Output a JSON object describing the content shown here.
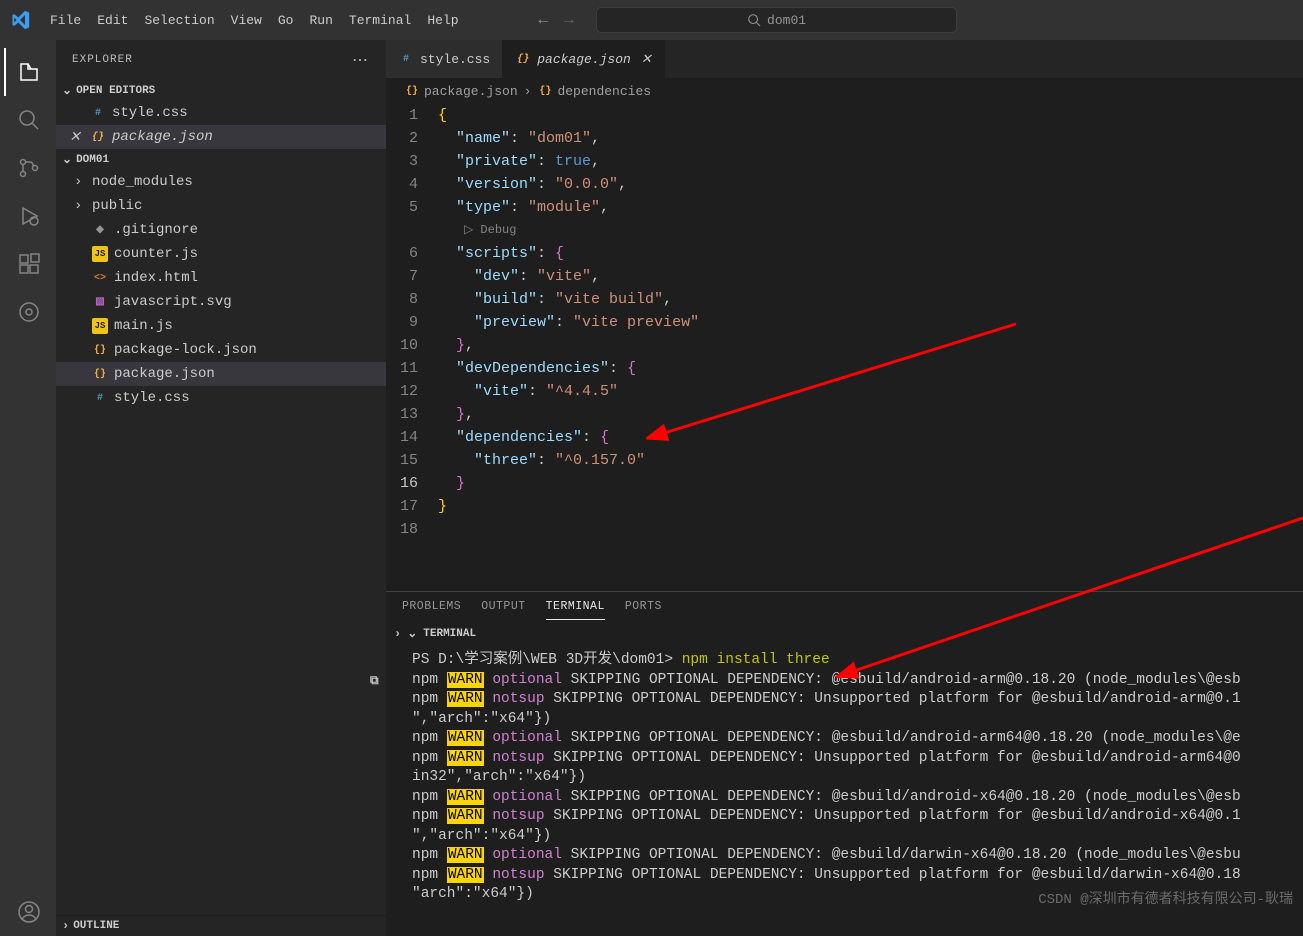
{
  "titlebar": {
    "menu": [
      "File",
      "Edit",
      "Selection",
      "View",
      "Go",
      "Run",
      "Terminal",
      "Help"
    ],
    "search": "dom01"
  },
  "sidebar": {
    "title": "EXPLORER",
    "openEditors": {
      "label": "OPEN EDITORS",
      "items": [
        {
          "name": "style.css",
          "icon": "css"
        },
        {
          "name": "package.json",
          "icon": "json",
          "active": true,
          "italic": true
        }
      ]
    },
    "project": {
      "label": "DOM01",
      "items": [
        {
          "name": "node_modules",
          "type": "folder"
        },
        {
          "name": "public",
          "type": "folder"
        },
        {
          "name": ".gitignore",
          "icon": "git"
        },
        {
          "name": "counter.js",
          "icon": "js"
        },
        {
          "name": "index.html",
          "icon": "html"
        },
        {
          "name": "javascript.svg",
          "icon": "svg"
        },
        {
          "name": "main.js",
          "icon": "js"
        },
        {
          "name": "package-lock.json",
          "icon": "json"
        },
        {
          "name": "package.json",
          "icon": "json",
          "selected": true
        },
        {
          "name": "style.css",
          "icon": "css"
        }
      ]
    },
    "outline": "OUTLINE"
  },
  "tabs": [
    {
      "name": "style.css",
      "icon": "css"
    },
    {
      "name": "package.json",
      "icon": "json",
      "active": true,
      "italic": true
    }
  ],
  "breadcrumb": [
    "package.json",
    "dependencies"
  ],
  "code": {
    "debugLabel": "Debug",
    "lines": [
      {
        "n": 1,
        "tokens": [
          {
            "t": "{",
            "c": "brace"
          }
        ]
      },
      {
        "n": 2,
        "tokens": [
          "  ",
          {
            "t": "\"name\"",
            "c": "key"
          },
          {
            "t": ": ",
            "c": "punct"
          },
          {
            "t": "\"dom01\"",
            "c": "str"
          },
          {
            "t": ",",
            "c": "punct"
          }
        ]
      },
      {
        "n": 3,
        "tokens": [
          "  ",
          {
            "t": "\"private\"",
            "c": "key"
          },
          {
            "t": ": ",
            "c": "punct"
          },
          {
            "t": "true",
            "c": "kw"
          },
          {
            "t": ",",
            "c": "punct"
          }
        ]
      },
      {
        "n": 4,
        "tokens": [
          "  ",
          {
            "t": "\"version\"",
            "c": "key"
          },
          {
            "t": ": ",
            "c": "punct"
          },
          {
            "t": "\"0.0.0\"",
            "c": "str"
          },
          {
            "t": ",",
            "c": "punct"
          }
        ]
      },
      {
        "n": 5,
        "tokens": [
          "  ",
          {
            "t": "\"type\"",
            "c": "key"
          },
          {
            "t": ": ",
            "c": "punct"
          },
          {
            "t": "\"module\"",
            "c": "str"
          },
          {
            "t": ",",
            "c": "punct"
          }
        ]
      },
      {
        "debug": true
      },
      {
        "n": 6,
        "tokens": [
          "  ",
          {
            "t": "\"scripts\"",
            "c": "key"
          },
          {
            "t": ": ",
            "c": "punct"
          },
          {
            "t": "{",
            "c": "brace2"
          }
        ]
      },
      {
        "n": 7,
        "tokens": [
          "    ",
          {
            "t": "\"dev\"",
            "c": "key"
          },
          {
            "t": ": ",
            "c": "punct"
          },
          {
            "t": "\"vite\"",
            "c": "str"
          },
          {
            "t": ",",
            "c": "punct"
          }
        ]
      },
      {
        "n": 8,
        "tokens": [
          "    ",
          {
            "t": "\"build\"",
            "c": "key"
          },
          {
            "t": ": ",
            "c": "punct"
          },
          {
            "t": "\"vite build\"",
            "c": "str"
          },
          {
            "t": ",",
            "c": "punct"
          }
        ]
      },
      {
        "n": 9,
        "tokens": [
          "    ",
          {
            "t": "\"preview\"",
            "c": "key"
          },
          {
            "t": ": ",
            "c": "punct"
          },
          {
            "t": "\"vite preview\"",
            "c": "str"
          }
        ]
      },
      {
        "n": 10,
        "tokens": [
          "  ",
          {
            "t": "}",
            "c": "brace2"
          },
          {
            "t": ",",
            "c": "punct"
          }
        ]
      },
      {
        "n": 11,
        "tokens": [
          "  ",
          {
            "t": "\"devDependencies\"",
            "c": "key"
          },
          {
            "t": ": ",
            "c": "punct"
          },
          {
            "t": "{",
            "c": "brace2"
          }
        ]
      },
      {
        "n": 12,
        "tokens": [
          "    ",
          {
            "t": "\"vite\"",
            "c": "key"
          },
          {
            "t": ": ",
            "c": "punct"
          },
          {
            "t": "\"^4.4.5\"",
            "c": "str"
          }
        ]
      },
      {
        "n": 13,
        "tokens": [
          "  ",
          {
            "t": "}",
            "c": "brace2"
          },
          {
            "t": ",",
            "c": "punct"
          }
        ]
      },
      {
        "n": 14,
        "tokens": [
          "  ",
          {
            "t": "\"dependencies\"",
            "c": "key"
          },
          {
            "t": ": ",
            "c": "punct"
          },
          {
            "t": "{",
            "c": "brace2"
          }
        ]
      },
      {
        "n": 15,
        "tokens": [
          "    ",
          {
            "t": "\"three\"",
            "c": "key"
          },
          {
            "t": ": ",
            "c": "punct"
          },
          {
            "t": "\"^0.157.0\"",
            "c": "str"
          }
        ]
      },
      {
        "n": 16,
        "tokens": [
          "  ",
          {
            "t": "}",
            "c": "brace2"
          }
        ],
        "current": true
      },
      {
        "n": 17,
        "tokens": [
          {
            "t": "}",
            "c": "brace"
          }
        ]
      },
      {
        "n": 18,
        "tokens": []
      }
    ]
  },
  "panel": {
    "tabs": [
      "PROBLEMS",
      "OUTPUT",
      "TERMINAL",
      "PORTS"
    ],
    "activeTab": "TERMINAL",
    "sectionLabel": "TERMINAL",
    "terminal": {
      "prompt": "PS D:\\学习案例\\WEB 3D开发\\dom01> ",
      "command": "npm install three",
      "lines": [
        [
          {
            "t": "npm",
            "c": "npm"
          },
          " ",
          {
            "t": "WARN",
            "c": "warn"
          },
          " ",
          {
            "t": "optional",
            "c": "cat"
          },
          " ",
          {
            "t": "SKIPPING OPTIONAL DEPENDENCY: @esbuild/android-arm@0.18.20 (node_modules\\@esb",
            "c": "text"
          }
        ],
        [
          {
            "t": "npm",
            "c": "npm"
          },
          " ",
          {
            "t": "WARN",
            "c": "warn"
          },
          " ",
          {
            "t": "notsup",
            "c": "cat"
          },
          " ",
          {
            "t": "SKIPPING OPTIONAL DEPENDENCY: Unsupported platform for @esbuild/android-arm@0.1",
            "c": "text"
          }
        ],
        [
          {
            "t": "\",\"arch\":\"x64\"})",
            "c": "text"
          }
        ],
        [
          {
            "t": "npm",
            "c": "npm"
          },
          " ",
          {
            "t": "WARN",
            "c": "warn"
          },
          " ",
          {
            "t": "optional",
            "c": "cat"
          },
          " ",
          {
            "t": "SKIPPING OPTIONAL DEPENDENCY: @esbuild/android-arm64@0.18.20 (node_modules\\@e",
            "c": "text"
          }
        ],
        [
          {
            "t": "npm",
            "c": "npm"
          },
          " ",
          {
            "t": "WARN",
            "c": "warn"
          },
          " ",
          {
            "t": "notsup",
            "c": "cat"
          },
          " ",
          {
            "t": "SKIPPING OPTIONAL DEPENDENCY: Unsupported platform for @esbuild/android-arm64@0",
            "c": "text"
          }
        ],
        [
          {
            "t": "in32\",\"arch\":\"x64\"})",
            "c": "text"
          }
        ],
        [
          {
            "t": "npm",
            "c": "npm"
          },
          " ",
          {
            "t": "WARN",
            "c": "warn"
          },
          " ",
          {
            "t": "optional",
            "c": "cat"
          },
          " ",
          {
            "t": "SKIPPING OPTIONAL DEPENDENCY: @esbuild/android-x64@0.18.20 (node_modules\\@esb",
            "c": "text"
          }
        ],
        [
          {
            "t": "npm",
            "c": "npm"
          },
          " ",
          {
            "t": "WARN",
            "c": "warn"
          },
          " ",
          {
            "t": "notsup",
            "c": "cat"
          },
          " ",
          {
            "t": "SKIPPING OPTIONAL DEPENDENCY: Unsupported platform for @esbuild/android-x64@0.1",
            "c": "text"
          }
        ],
        [
          {
            "t": "\",\"arch\":\"x64\"})",
            "c": "text"
          }
        ],
        [
          {
            "t": "npm",
            "c": "npm"
          },
          " ",
          {
            "t": "WARN",
            "c": "warn"
          },
          " ",
          {
            "t": "optional",
            "c": "cat"
          },
          " ",
          {
            "t": "SKIPPING OPTIONAL DEPENDENCY: @esbuild/darwin-x64@0.18.20 (node_modules\\@esbu",
            "c": "text"
          }
        ],
        [
          {
            "t": "npm",
            "c": "npm"
          },
          " ",
          {
            "t": "WARN",
            "c": "warn"
          },
          " ",
          {
            "t": "notsup",
            "c": "cat"
          },
          " ",
          {
            "t": "SKIPPING OPTIONAL DEPENDENCY: Unsupported platform for @esbuild/darwin-x64@0.18",
            "c": "text"
          }
        ],
        [
          {
            "t": "\"arch\":\"x64\"})",
            "c": "text"
          }
        ]
      ]
    }
  },
  "watermark": "CSDN @深圳市有德者科技有限公司-耿瑞"
}
